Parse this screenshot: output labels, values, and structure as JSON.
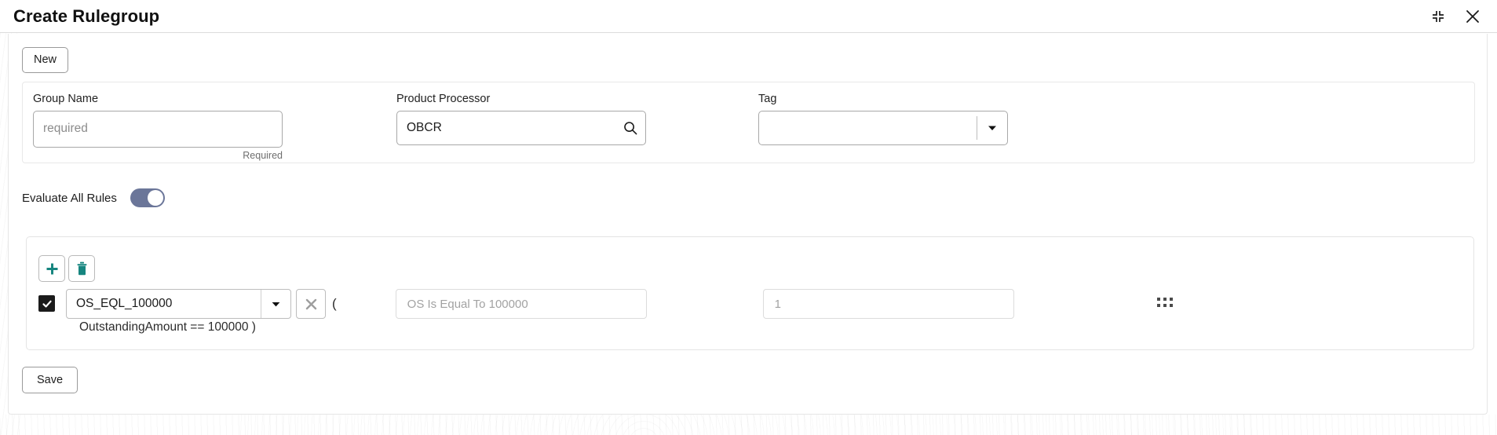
{
  "header": {
    "title": "Create Rulegroup",
    "minimize_icon": "collapse-icon",
    "close_icon": "close-icon"
  },
  "toolbar": {
    "new_label": "New"
  },
  "form": {
    "group_name": {
      "label": "Group Name",
      "value": "",
      "placeholder": "required",
      "helper": "Required"
    },
    "product_processor": {
      "label": "Product Processor",
      "value": "OBCR",
      "placeholder": "",
      "icon": "search-icon"
    },
    "tag": {
      "label": "Tag",
      "value": "",
      "placeholder": "",
      "icon": "chevron-down-icon"
    },
    "evaluate_all_rules": {
      "label": "Evaluate All Rules",
      "state": "on"
    }
  },
  "rules": {
    "add_icon": "plus-icon",
    "delete_icon": "trash-icon",
    "rows": [
      {
        "checked": true,
        "rule_name": "OS_EQL_100000",
        "dropdown_icon": "chevron-down-icon",
        "remove_icon": "close-x-icon",
        "open_paren": "(",
        "description": "OS Is Equal To 100000",
        "priority": "1",
        "expression": "OutstandingAmount == 100000 )",
        "drag_icon": "drag-handle-icon"
      }
    ]
  },
  "footer": {
    "save_label": "Save"
  },
  "colors": {
    "accent_teal": "#16857f",
    "toggle_on": "#6b7699",
    "checkbox": "#1b1b1b",
    "border": "#bdbdbd",
    "muted_text": "#8c8c8c"
  }
}
